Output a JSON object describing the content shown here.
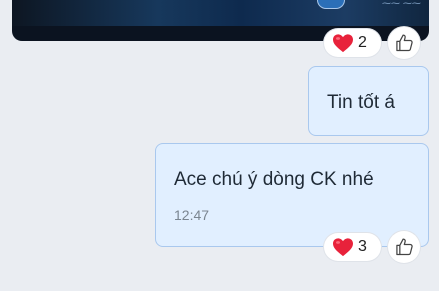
{
  "messages": [
    {
      "text": "Tin tốt á",
      "reaction": {
        "icon": "heart-icon",
        "count": "2"
      }
    },
    {
      "text": "Ace chú ý dòng CK nhé",
      "time": "12:47",
      "reaction": {
        "icon": "heart-icon",
        "count": "3"
      }
    }
  ],
  "colors": {
    "background": "#eaedf2",
    "bubble": "#e1efff",
    "bubble_border": "#a9c8ee",
    "heart": "#e8223b"
  }
}
